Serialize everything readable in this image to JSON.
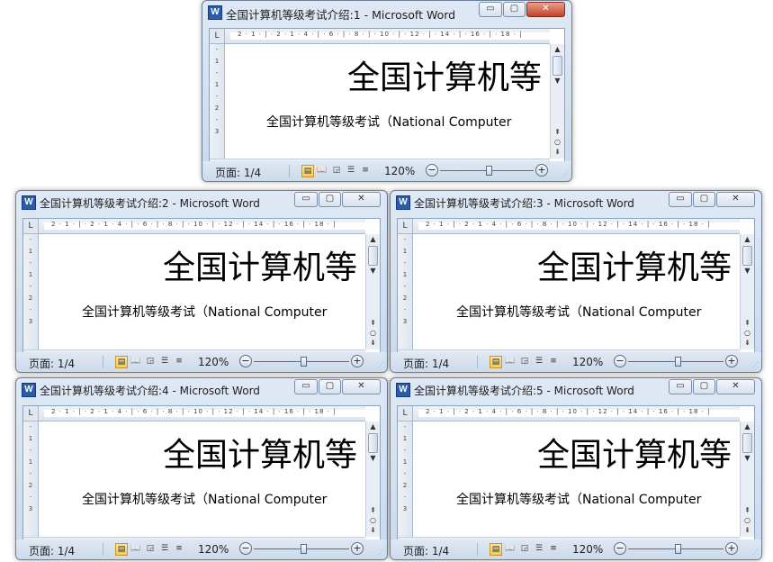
{
  "windows": [
    {
      "title": "全国计算机等级考试介绍:1 - Microsoft Word",
      "close_style": "hot"
    },
    {
      "title": "全国计算机等级考试介绍:2 - Microsoft Word",
      "close_style": "normal"
    },
    {
      "title": "全国计算机等级考试介绍:3 - Microsoft Word",
      "close_style": "normal"
    },
    {
      "title": "全国计算机等级考试介绍:4 - Microsoft Word",
      "close_style": "normal"
    },
    {
      "title": "全国计算机等级考试介绍:5 - Microsoft Word",
      "close_style": "normal"
    }
  ],
  "document": {
    "heading": "全国计算机等",
    "first_line": "全国计算机等级考试（National Computer"
  },
  "ruler": {
    "numbers": "2 · 1 · | · 2 · 1 · 4 · | · 6 · | · 8 · | · 10 · | · 12 · | · 14 · | · 16 · | · 18 · |",
    "vertical": [
      "-",
      "1",
      "-",
      "1",
      "-",
      "2",
      "-",
      "3"
    ]
  },
  "status": {
    "page_count": "页面: 1/4",
    "zoom_level": "120%",
    "zoom_out": "−",
    "zoom_in": "+",
    "zoom_fraction": 0.52
  },
  "controls": {
    "minimize": "▭",
    "maximize": "▢",
    "close": "✕"
  },
  "icons": {
    "app": "W",
    "scroll_up": "▲",
    "scroll_down": "▼",
    "scroll_left": "◀",
    "scroll_right": "▶",
    "prev_page": "⇞",
    "select_browse": "○",
    "next_page": "⇟",
    "thumb_grip": "|||",
    "ruler_tab": "L",
    "view_options": "⊞"
  },
  "colors": {
    "title_bar": "#dfe9f5",
    "close_hot": "#c2432a",
    "active_view": "#f6c65a"
  }
}
